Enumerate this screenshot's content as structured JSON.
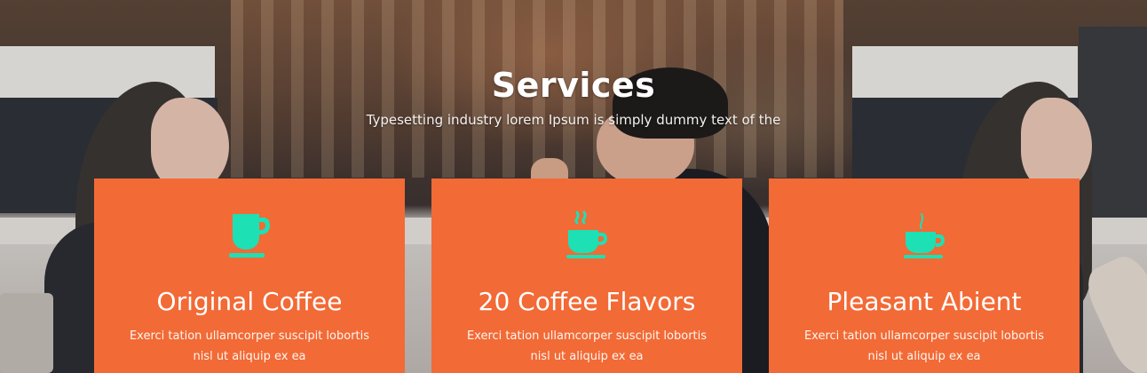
{
  "section": {
    "title": "Services",
    "subtitle": "Typesetting industry lorem Ipsum is simply dummy text of the"
  },
  "colors": {
    "card_background": "#f26a36",
    "icon_color": "#1de0b4",
    "text": "#ffffff"
  },
  "cards": [
    {
      "icon": "coffee-cup-icon",
      "title": "Original Coffee",
      "text": "Exerci tation ullamcorper suscipit lobortis nisl ut aliquip ex ea"
    },
    {
      "icon": "steaming-coffee-icon",
      "title": "20 Coffee Flavors",
      "text": "Exerci tation ullamcorper suscipit lobortis nisl ut aliquip ex ea"
    },
    {
      "icon": "hot-cup-icon",
      "title": "Pleasant Abient",
      "text": "Exerci tation ullamcorper suscipit lobortis nisl ut aliquip ex ea"
    }
  ]
}
